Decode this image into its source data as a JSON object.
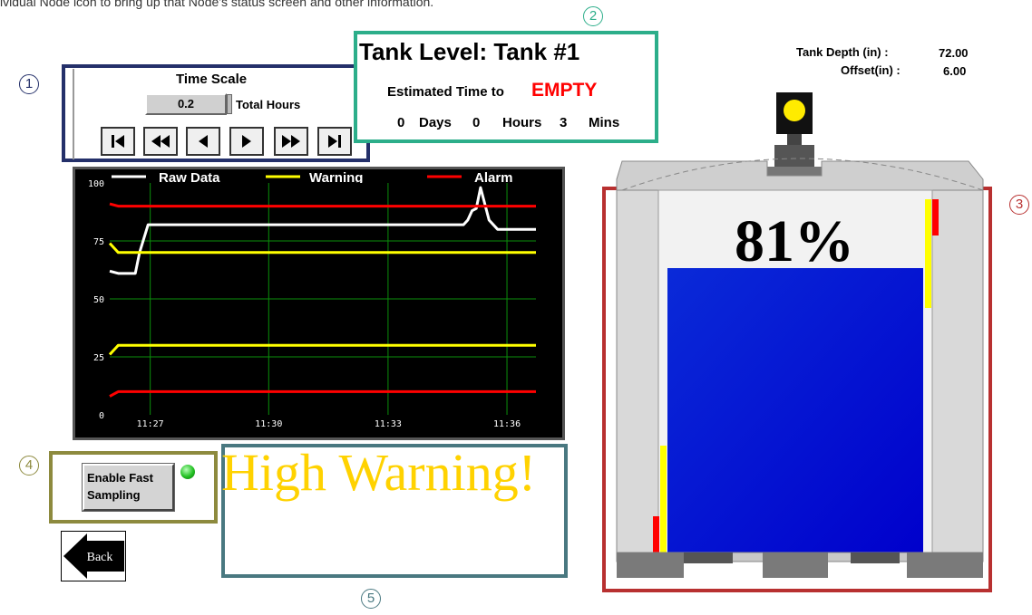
{
  "intro_text": "ividual Node icon to bring up that Node's status screen and other information.",
  "callouts": [
    "1",
    "2",
    "3",
    "4",
    "5"
  ],
  "time_scale": {
    "title": "Time Scale",
    "value": "0.2",
    "unit": "Total Hours",
    "buttons": [
      "first",
      "rewind",
      "back",
      "forward",
      "fast-forward",
      "last"
    ]
  },
  "tank_level": {
    "title": "Tank Level: Tank #1",
    "estimated_label": "Estimated Time to",
    "estimated_state": "EMPTY",
    "days": "0",
    "days_label": "Days",
    "hours": "0",
    "hours_label": "Hours",
    "mins": "3",
    "mins_label": "Mins"
  },
  "tank_info": {
    "depth_label": "Tank Depth (in) :",
    "depth_value": "72.00",
    "offset_label": "Offset(in) :",
    "offset_value": "6.00"
  },
  "chart_data": {
    "type": "line",
    "legend": [
      "Raw Data",
      "Warning",
      "Alarm"
    ],
    "x_ticks": [
      "11:27",
      "11:30",
      "11:33",
      "11:36"
    ],
    "y_ticks": [
      "0",
      "25",
      "50",
      "75",
      "100"
    ],
    "ylim": [
      0,
      100
    ],
    "xlim": [
      0,
      100
    ],
    "series": [
      {
        "name": "Raw Data",
        "color": "#ffffff",
        "x": [
          0,
          2,
          6,
          7,
          9,
          83,
          84,
          85,
          86,
          87,
          89,
          91,
          94,
          100
        ],
        "y": [
          62,
          61,
          61,
          70,
          82,
          82,
          84,
          88,
          89,
          98,
          84,
          80,
          80,
          80
        ]
      },
      {
        "name": "Warning",
        "color": "#ffff00",
        "x": [
          0,
          2,
          100
        ],
        "y": [
          74,
          70,
          70
        ]
      },
      {
        "name": "Warning",
        "color": "#ffff00",
        "x": [
          0,
          2,
          100
        ],
        "y": [
          26,
          30,
          30
        ]
      },
      {
        "name": "Alarm",
        "color": "#ff0000",
        "x": [
          0,
          2,
          100
        ],
        "y": [
          91,
          90,
          90
        ]
      },
      {
        "name": "Alarm",
        "color": "#ff0000",
        "x": [
          0,
          2,
          100
        ],
        "y": [
          8,
          10,
          10
        ]
      }
    ]
  },
  "sampling": {
    "button_label_line1": "Enable Fast",
    "button_label_line2": "Sampling",
    "led_color": "#22c022"
  },
  "back_label": "Back",
  "warning_text": "High Warning!",
  "tank": {
    "percent_label": "81%",
    "fill_level": 0.81,
    "fill_color": "#0000cc"
  }
}
